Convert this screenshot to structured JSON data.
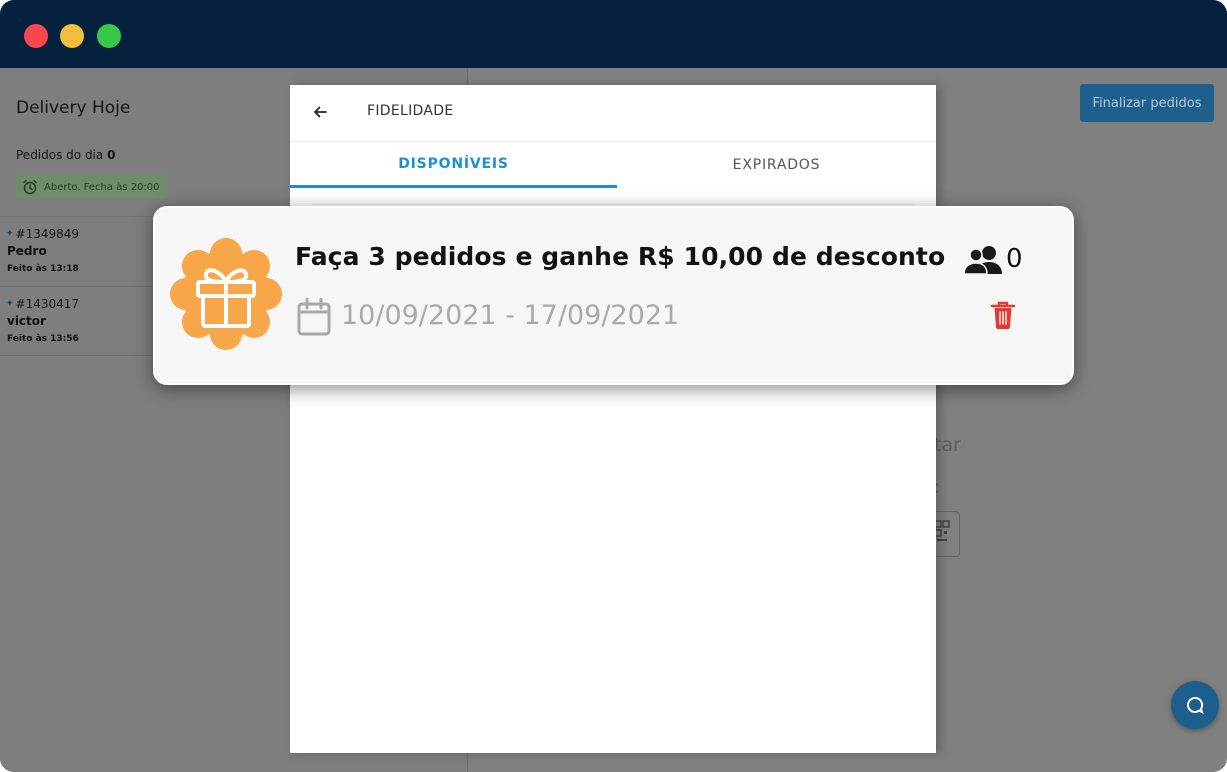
{
  "window": {
    "controls": [
      "close",
      "minimize",
      "maximize"
    ]
  },
  "sidebar": {
    "title": "Delivery Hoje",
    "orders_label": "Pedidos do dia",
    "orders_count": "0",
    "status": "Aberto. Fecha às 20:00",
    "orders": [
      {
        "number": "#1349849",
        "name": "Pedro",
        "time": "Feito às 13:18"
      },
      {
        "number": "#1430417",
        "name": "victor",
        "time": "Feito às 13:56"
      }
    ]
  },
  "main": {
    "finalize_label": "Finalizar pedidos",
    "partial_text_1": "tar",
    "partial_text_2": ":"
  },
  "modal": {
    "title": "FIDELIDADE",
    "tabs": [
      {
        "label": "DISPONÍVEIS",
        "active": true
      },
      {
        "label": "EXPIRADOS",
        "active": false
      }
    ]
  },
  "promo": {
    "title": "Faça 3 pedidos e ganhe R$ 10,00 de desconto",
    "dates": "10/09/2021 - 17/09/2021",
    "participants": "0",
    "icons": [
      "gift-badge-icon",
      "calendar-icon",
      "users-icon",
      "trash-icon"
    ]
  },
  "colors": {
    "titlebar": "#04213e",
    "accent": "#1d8fd3",
    "badge": "#f8a64a",
    "delete": "#e53935"
  }
}
